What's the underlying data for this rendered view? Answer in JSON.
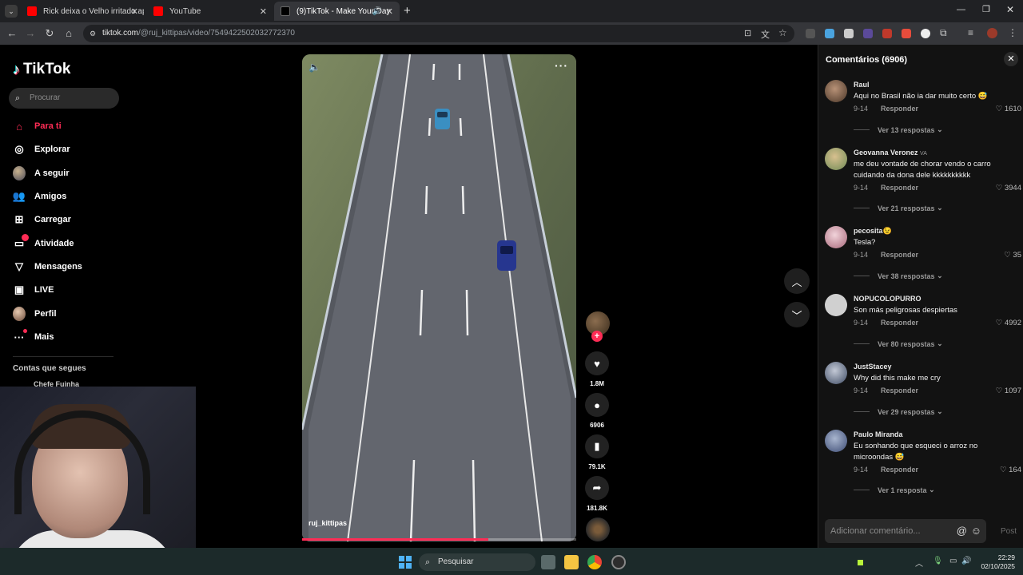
{
  "browser": {
    "tabs": [
      {
        "title": "Rick deixa o Velho irritado após",
        "favicon": "youtube-icon",
        "active": false
      },
      {
        "title": "YouTube",
        "favicon": "youtube-icon",
        "active": false
      },
      {
        "title": "(9)TikTok - Make Your Day",
        "favicon": "tiktok-icon",
        "active": true
      }
    ],
    "url_host": "tiktok.com",
    "url_path": "/@ruj_kittipas/video/7549422502032772370"
  },
  "sidebar": {
    "logo": "TikTok",
    "search_placeholder": "Procurar",
    "items": [
      {
        "label": "Para ti",
        "icon": "home-icon"
      },
      {
        "label": "Explorar",
        "icon": "compass-icon"
      },
      {
        "label": "A seguir",
        "icon": "avatar"
      },
      {
        "label": "Amigos",
        "icon": "friends-icon"
      },
      {
        "label": "Carregar",
        "icon": "upload-icon"
      },
      {
        "label": "Atividade",
        "icon": "activity-icon"
      },
      {
        "label": "Mensagens",
        "icon": "send-icon"
      },
      {
        "label": "LIVE",
        "icon": "live-icon"
      },
      {
        "label": "Perfil",
        "icon": "avatar"
      },
      {
        "label": "Mais",
        "icon": "more-icon"
      }
    ],
    "following_header": "Contas que segues",
    "following_first": "Chefe Fuinha"
  },
  "video": {
    "username": "ruj_kittipas",
    "progress": 0.68
  },
  "actions": {
    "likes": "1.8M",
    "comments": "6906",
    "saves": "79.1K",
    "shares": "181.8K"
  },
  "comments": {
    "title": "Comentários (6906)",
    "add_placeholder": "Adicionar comentário...",
    "post_label": "Post",
    "list": [
      {
        "name": "Raul",
        "text": "Aqui no Brasil não ia dar muito certo 😅",
        "date": "9-14",
        "reply": "Responder",
        "likes": "1610",
        "replies": "Ver 13 respostas",
        "avatar_color": "#8a6a55"
      },
      {
        "name": "Geovanna Veronez",
        "badge": "VA",
        "text": "me deu vontade de chorar vendo o carro cuidando da dona dele kkkkkkkkkk",
        "date": "9-14",
        "reply": "Responder",
        "likes": "3944",
        "replies": "Ver 21 respostas",
        "avatar_color": "#9ab07a"
      },
      {
        "name": "pecosita😉",
        "text": "Tesla?",
        "date": "9-14",
        "reply": "Responder",
        "likes": "35",
        "replies": "Ver 38 respostas",
        "avatar_color": "#d8a9b6"
      },
      {
        "name": "NOPUCOLOPURRO",
        "text": "Son más peligrosas despiertas",
        "date": "9-14",
        "reply": "Responder",
        "likes": "4992",
        "replies": "Ver 80 respostas",
        "avatar_color": "#d0d0d0"
      },
      {
        "name": "JustStacey",
        "text": "Why did this make me cry",
        "date": "9-14",
        "reply": "Responder",
        "likes": "1097",
        "replies": "Ver 29 respostas",
        "avatar_color": "#5a6f8a"
      },
      {
        "name": "Paulo Miranda",
        "text": "Eu sonhando que esqueci o arroz no microondas 😅",
        "date": "9-14",
        "reply": "Responder",
        "likes": "164",
        "replies": "Ver 1 resposta",
        "avatar_color": "#6b7fa3"
      }
    ]
  },
  "taskbar": {
    "search_label": "Pesquisar",
    "time": "22:29",
    "date": "02/10/2025"
  }
}
